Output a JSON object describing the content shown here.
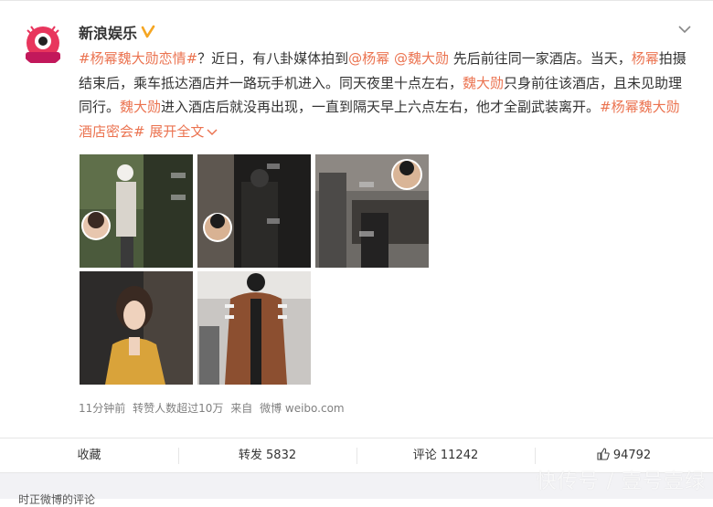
{
  "account": {
    "name": "新浪娱乐",
    "avatar_label": "新浪娱乐"
  },
  "post": {
    "segments": [
      {
        "text": "#杨幂魏大勋恋情#",
        "link": true
      },
      {
        "text": "？近日，有八卦媒体拍到",
        "link": false
      },
      {
        "text": "@杨幂",
        "link": true
      },
      {
        "text": " ",
        "link": false
      },
      {
        "text": "@魏大勋",
        "link": true
      },
      {
        "text": " 先后前往同一家酒店。当天，",
        "link": false
      },
      {
        "text": "杨幂",
        "link": true
      },
      {
        "text": "拍摄结束后，乘车抵达酒店并一路玩手机进入。同天夜里十点左右，",
        "link": false
      },
      {
        "text": "魏大勋",
        "link": true
      },
      {
        "text": "只身前往该酒店，且未见助理同行。",
        "link": false
      },
      {
        "text": "魏大勋",
        "link": true
      },
      {
        "text": "进入酒店后就没再出现，一直到隔天早上六点左右，他才全副武装离开。",
        "link": false
      },
      {
        "text": "#杨幂魏大勋酒店密会#",
        "link": true
      },
      {
        "text": " ",
        "link": false
      }
    ],
    "expand_label": "展开全文"
  },
  "meta": {
    "time": "11分钟前",
    "reposts_note": "转赞人数超过10万",
    "source_prefix": "来自",
    "source": "微博 weibo.com"
  },
  "actions": {
    "favorite": "收藏",
    "repost_label": "转发",
    "repost_count": "5832",
    "comment_label": "评论",
    "comment_count": "11242",
    "like_count": "94792"
  },
  "bottom": {
    "partial_text": "时正微博的评论"
  },
  "watermark": "快传号 / 壹号壹绿",
  "colors": {
    "link": "#eb7350",
    "verified": "#f5a623",
    "text": "#333333",
    "meta": "#808080"
  }
}
